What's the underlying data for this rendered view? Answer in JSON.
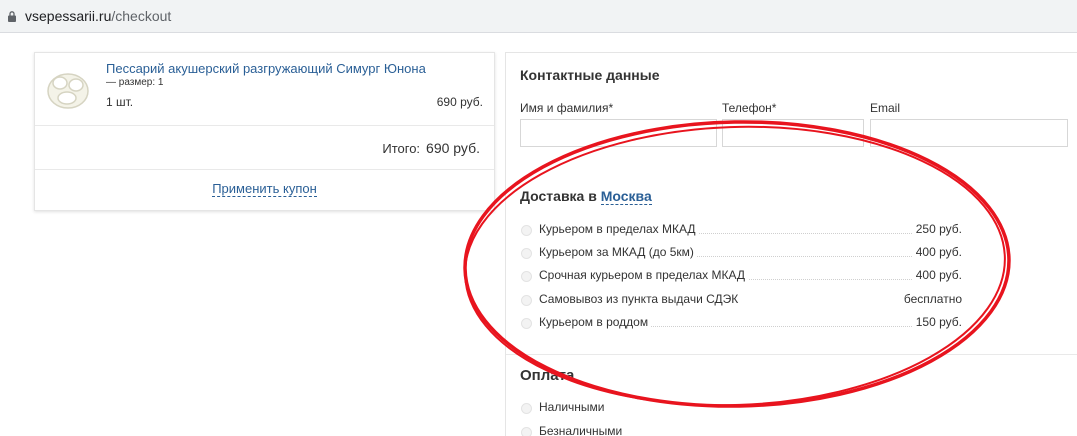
{
  "browser": {
    "url_host": "vsepessarii.ru",
    "url_path": "/checkout",
    "icon": "lock-icon"
  },
  "cart": {
    "product_image": "pessary-image",
    "product_name": "Пессарий акушерский разгружающий Симург Юнона",
    "product_size": "— размер: 1",
    "quantity": "1 шт.",
    "price": "690 руб.",
    "total_label": "Итого:",
    "total_value": "690 руб.",
    "coupon_link": "Применить купон"
  },
  "contacts": {
    "title": "Контактные данные",
    "fields": [
      {
        "label": "Имя и фамилия*",
        "value": ""
      },
      {
        "label": "Телефон*",
        "value": ""
      },
      {
        "label": "Email",
        "value": ""
      }
    ]
  },
  "delivery": {
    "title": "Доставка в",
    "city": "Москва",
    "options": [
      {
        "label": "Курьером в пределах МКАД",
        "price": "250 руб."
      },
      {
        "label": "Курьером за МКАД (до 5км)",
        "price": "400 руб."
      },
      {
        "label": "Срочная курьером в пределах МКАД",
        "price": "400 руб."
      },
      {
        "label": "Самовывоз из пункта выдачи СДЭК",
        "price": "бесплатно"
      },
      {
        "label": "Курьером в роддом",
        "price": "150 руб."
      }
    ]
  },
  "payment": {
    "title": "Оплата",
    "options": [
      {
        "label": "Наличными"
      },
      {
        "label": "Безналичными"
      }
    ]
  },
  "colors": {
    "link": "#2a5f96",
    "annotation": "#e8141e"
  }
}
